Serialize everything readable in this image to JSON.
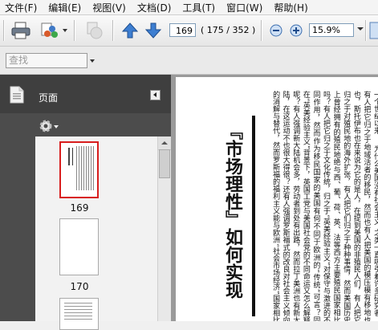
{
  "menu": [
    "文件(F)",
    "编辑(E)",
    "视图(V)",
    "文档(D)",
    "工具(T)",
    "窗口(W)",
    "帮助(H)"
  ],
  "toolbar": {
    "current_page": "169",
    "page_count": "( 175 / 352 )",
    "zoom": "15.9%"
  },
  "find": {
    "placeholder": "查找"
  },
  "nav": {
    "title": "页面",
    "thumbnails": [
      {
        "label": "169",
        "selected": true
      },
      {
        "label": "170",
        "selected": false
      }
    ]
  },
  "document": {
    "title": "『市场理性』如何实现",
    "body": "一个世纪以来，“为什么美国没有社会主义”之类一直吸引着许多研究者。有人把它归之于地域活者的移民，然而也有人把美国的模压模有移地也也，斯托伊布也在来说为它的是人，在提到美国的非殖民人们，有人把它归之于对殖民地的海外扩张，有人把它们归之于种种事情，然而美国历史上曾经拥有的殖民地绝与西、葡、荷、英、法等西方主要殖民国家相比吗？有人把它归之于文化传统，归之于“英美经验主义”对保守与激进的不同作用，然而作为移民国家的美国有何不同于欧洲的“传统”可言？同在“英美经验主义”背景下，英国工党与美国社会党的不同命运又怎么解释呢？有人强调新大陆机会多，劳动者到处有出路，然而拉丁美洲也有新大陆，在这运动不也很大得很？还有人强调罗斯福式的改良对社会主义倾向的消解与替代，然而罗斯福的福利主义能与欧洲“社会市场经济”国家相比吗？更何况罗斯福以前“美国为何没有社会主义”的问题早已存在？"
  }
}
